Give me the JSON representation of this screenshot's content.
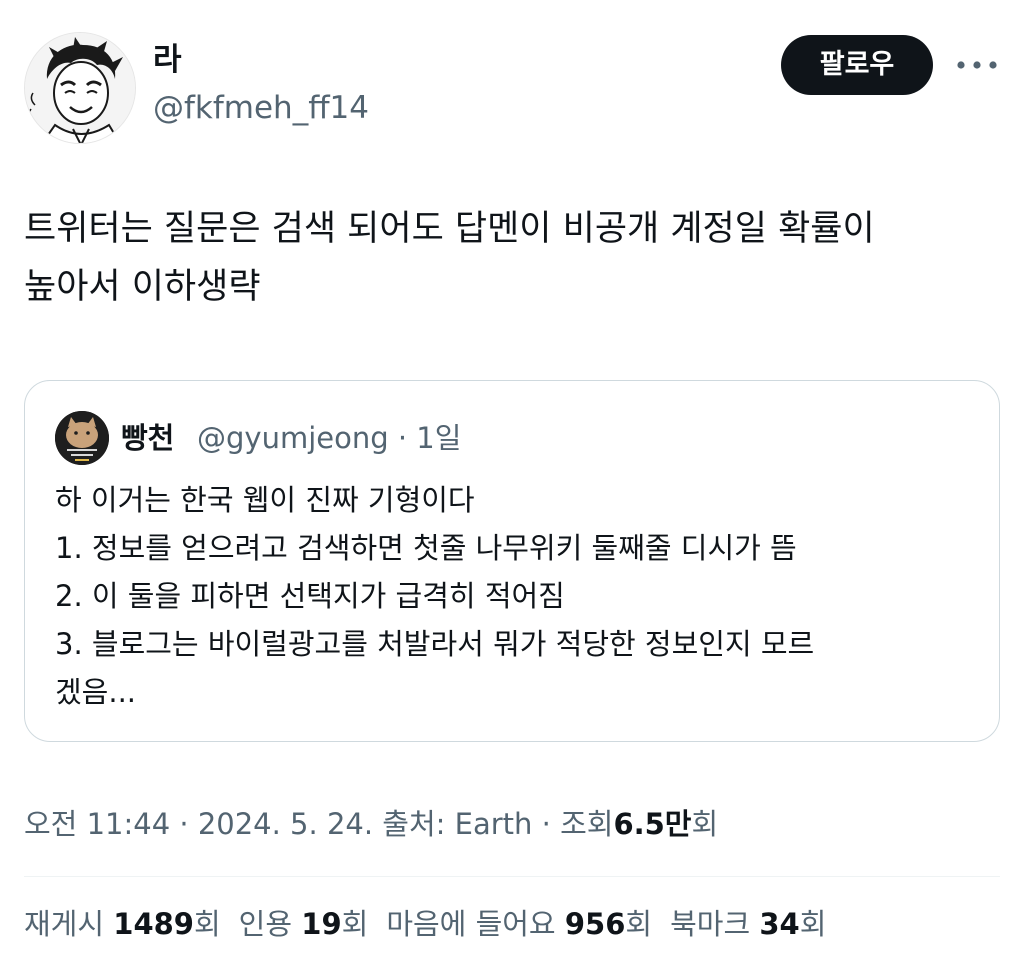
{
  "author": {
    "display_name": "라",
    "handle": "@fkfmeh_ff14"
  },
  "follow_button": {
    "label": "팔로우"
  },
  "more_icon": "more-horizontal-icon",
  "tweet": {
    "text": "트위터는 질문은 검색 되어도 답멘이 비공개 계정일 확률이\n높아서 이하생략"
  },
  "quote": {
    "display_name": "빵천",
    "handle": "@gyumjeong",
    "separator": "·",
    "time": "1일",
    "text": "하 이거는 한국 웹이 진짜 기형이다\n1. 정보를 얻으려고 검색하면 첫줄 나무위키 둘째줄 디시가 뜸\n2. 이 둘을 피하면 선택지가 급격히 적어짐\n3. 블로그는 바이럴광고를 처발라서 뭐가 적당한 정보인지 모르\n겠음..."
  },
  "meta": {
    "time": "오전 11:44",
    "sep1": "·",
    "date": "2024. 5. 24.",
    "source_label": "출처: Earth",
    "sep2": "·",
    "views_label": "조회",
    "views_value": "6.5만",
    "views_unit": "회"
  },
  "stats": {
    "retweets_label": "재게시",
    "retweets_value": "1489",
    "retweets_unit": "회",
    "quotes_label": "인용",
    "quotes_value": "19",
    "quotes_unit": "회",
    "likes_label": "마음에 들어요",
    "likes_value": "956",
    "likes_unit": "회",
    "bookmarks_label": "북마크",
    "bookmarks_value": "34",
    "bookmarks_unit": "회"
  },
  "colors": {
    "text_primary": "#0f1419",
    "text_secondary": "#536471",
    "border": "#cfd9de",
    "button_bg": "#0f1419",
    "button_text": "#ffffff"
  }
}
